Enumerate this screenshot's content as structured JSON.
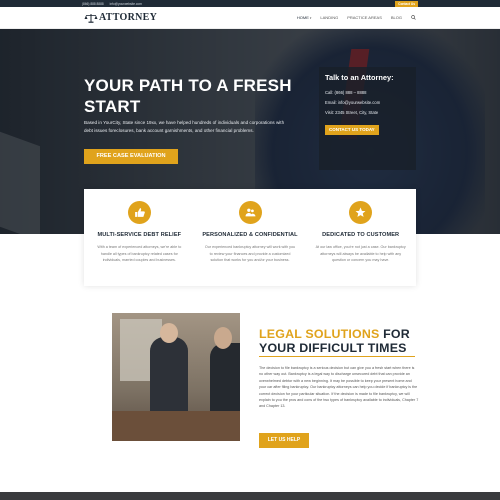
{
  "topbar": {
    "phone": "(866) 888 8888",
    "email": "info@yourwebsite.com",
    "contact": "Contact Us"
  },
  "nav": {
    "brand": "ATTORNEY",
    "items": [
      "HOME",
      "LANDING",
      "PRACTICE AREAS",
      "BLOG"
    ]
  },
  "hero": {
    "title": "YOUR PATH TO A FRESH START",
    "lead": "Based in YourCity, State since 19xx, we have helped hundreds of individuals and corporations with debt issues foreclosures, bank account garnishments, and other financial problems.",
    "cta": "FREE CASE EVALUATION"
  },
  "talk": {
    "title": "Talk to an Attorney:",
    "call": "Call: (866) 888 – 8888",
    "email": "Email: info@yourwebsite.com",
    "visit": "Visit: 2345 Street, City, State",
    "button": "CONTACT US TODAY"
  },
  "features": [
    {
      "icon": "thumbs-up-icon",
      "title": "MULTI-SERVICE DEBT RELIEF",
      "text": "With a team of experienced attorneys, we're able to handle all types of bankruptcy related cases for individuals, married couples and businesses."
    },
    {
      "icon": "users-icon",
      "title": "PERSONALIZED & CONFIDENTIAL",
      "text": "Our experienced bankruptcy attorney will work with you to review your finances and provide a customized solution that works for you and/or your business."
    },
    {
      "icon": "star-icon",
      "title": "DEDICATED TO CUSTOMER",
      "text": "At our law office, you're not just a case. Our bankruptcy attorneys will always be available to help with any question or concern you may have."
    }
  ],
  "legal": {
    "title_a": "LEGAL SOLUTIONS",
    "title_b": "FOR",
    "title_c": "YOUR DIFFICULT TIMES",
    "body": "The decision to file bankruptcy is a serious decision but can give you a fresh start when there is no other way out. Bankruptcy is a legal way to discharge unsecured debt that can provide an overwhelmed debtor with a new beginning. It may be possible to keep your present home and your car after filing bankruptcy. Our bankruptcy attorneys can help you decide if bankruptcy is the correct decision for your particular situation. If the decision is made to file bankruptcy, we will explain to you the pros and cons of the two types of bankruptcy available to individuals, Chapter 7 and Chapter 13.",
    "button": "LET US HELP"
  },
  "colors": {
    "accent": "#e0a31c",
    "navy": "#1f2a36"
  }
}
